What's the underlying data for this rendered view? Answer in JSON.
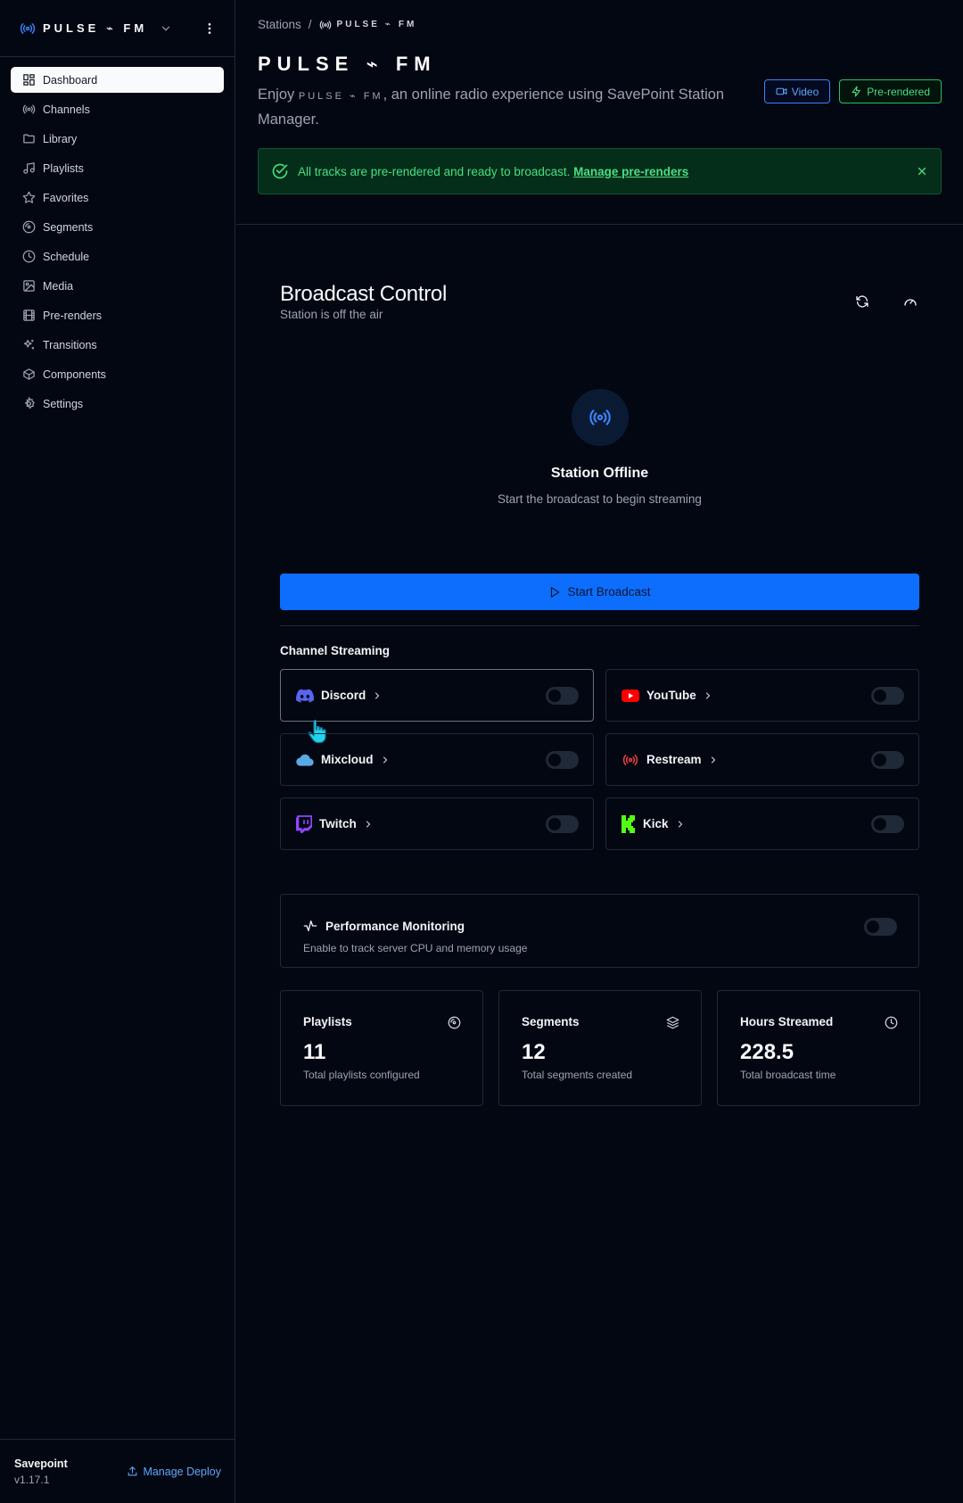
{
  "sidebar": {
    "brand_left": "PULSE",
    "brand_right": "FM",
    "items": [
      {
        "label": "Dashboard",
        "icon": "dashboard-icon",
        "active": true
      },
      {
        "label": "Channels",
        "icon": "broadcast-icon"
      },
      {
        "label": "Library",
        "icon": "folder-icon"
      },
      {
        "label": "Playlists",
        "icon": "music-icon"
      },
      {
        "label": "Favorites",
        "icon": "star-icon"
      },
      {
        "label": "Segments",
        "icon": "disc-icon"
      },
      {
        "label": "Schedule",
        "icon": "clock-icon"
      },
      {
        "label": "Media",
        "icon": "image-icon"
      },
      {
        "label": "Pre-renders",
        "icon": "film-icon"
      },
      {
        "label": "Transitions",
        "icon": "sparkles-icon"
      },
      {
        "label": "Components",
        "icon": "box-icon"
      },
      {
        "label": "Settings",
        "icon": "gear-icon"
      }
    ],
    "footer": {
      "name": "Savepoint",
      "version": "v1.17.1",
      "deploy_label": "Manage Deploy"
    }
  },
  "header": {
    "breadcrumb_root": "Stations",
    "breadcrumb_sep": "/",
    "breadcrumb_station_left": "PULSE",
    "breadcrumb_station_right": "FM",
    "title_left": "PULSE",
    "title_right": "FM",
    "desc_prefix": "Enjoy ",
    "desc_brand_left": "PULSE",
    "desc_brand_right": "FM",
    "desc_suffix": ", an online radio experience using SavePoint Station Manager.",
    "video_label": "Video",
    "prerendered_label": "Pre-rendered"
  },
  "alert": {
    "text": "All tracks are pre-rendered and ready to broadcast. ",
    "link": "Manage pre-renders"
  },
  "broadcast": {
    "title": "Broadcast Control",
    "subtitle": "Station is off the air",
    "status_title": "Station Offline",
    "status_sub": "Start the broadcast to begin streaming",
    "start_label": "Start Broadcast"
  },
  "channels": {
    "title": "Channel Streaming",
    "items": [
      {
        "name": "Discord",
        "color": "#5865F2",
        "enabled": false
      },
      {
        "name": "YouTube",
        "color": "#FF0000",
        "enabled": false
      },
      {
        "name": "Mixcloud",
        "color": "#5aa9e6",
        "enabled": false
      },
      {
        "name": "Restream",
        "color": "#ef4444",
        "enabled": false
      },
      {
        "name": "Twitch",
        "color": "#9146FF",
        "enabled": false
      },
      {
        "name": "Kick",
        "color": "#53FC18",
        "enabled": false
      }
    ]
  },
  "performance": {
    "title": "Performance Monitoring",
    "subtitle": "Enable to track server CPU and memory usage",
    "enabled": false
  },
  "stats": [
    {
      "label": "Playlists",
      "value": "11",
      "sub": "Total playlists configured",
      "icon": "disc-icon"
    },
    {
      "label": "Segments",
      "value": "12",
      "sub": "Total segments created",
      "icon": "layers-icon"
    },
    {
      "label": "Hours Streamed",
      "value": "228.5",
      "sub": "Total broadcast time",
      "icon": "clock-icon"
    }
  ],
  "colors": {
    "accent": "#0d6efd",
    "success": "#4ade80",
    "background": "#030712"
  }
}
